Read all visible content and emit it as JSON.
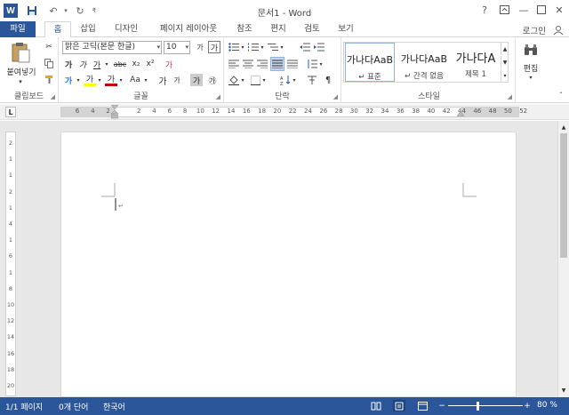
{
  "title": "문서1 - Word",
  "titlebar": {
    "help": "?",
    "undo_icon": "undo-icon",
    "redo_icon": "redo-icon"
  },
  "tabs": [
    "파일",
    "홈",
    "삽입",
    "디자인",
    "페이지 레이아웃",
    "참조",
    "편지",
    "검토",
    "보기"
  ],
  "login": "로그인",
  "clipboard": {
    "paste_label": "붙여넣기",
    "group_label": "클립보드"
  },
  "font": {
    "name": "맑은 고딕(본문 한글)",
    "size": "10",
    "group_label": "글꼴",
    "buttons": {
      "bold": "가",
      "italic": "가",
      "underline": "가",
      "strike": "abc",
      "sub": "x₂",
      "sup": "x²",
      "grow": "가",
      "shrink": "가",
      "clear": "가",
      "highlight": "가",
      "color": "가",
      "case": "Aa",
      "phonetic": "가",
      "border": "가",
      "circle": "㉮",
      "shade": "가"
    }
  },
  "paragraph": {
    "group_label": "단락"
  },
  "styles": {
    "group_label": "스타일",
    "items": [
      {
        "preview": "가나다AaB",
        "name": "↵ 표준"
      },
      {
        "preview": "가나다AaB",
        "name": "↵ 간격 없음"
      },
      {
        "preview": "가나다A",
        "name": "제목 1"
      }
    ]
  },
  "editing": {
    "label": "편집"
  },
  "ruler": {
    "corner": "L",
    "numbers": [
      "6",
      "4",
      "2",
      "",
      "2",
      "4",
      "6",
      "8",
      "10",
      "12",
      "14",
      "16",
      "18",
      "20",
      "22",
      "24",
      "26",
      "28",
      "30",
      "32",
      "34",
      "36",
      "38",
      "40",
      "42",
      "44",
      "46",
      "48",
      "50",
      "52"
    ],
    "vnumbers": [
      "2",
      "1",
      "1",
      "2",
      "1",
      "4",
      "1",
      "6",
      "1",
      "8",
      "10",
      "12",
      "14",
      "16",
      "18",
      "20"
    ]
  },
  "status": {
    "page": "1/1 페이지",
    "words": "0개 단어",
    "language": "한국어",
    "zoom": "80 %",
    "zoom_level_percent": 80
  },
  "colors": {
    "accent": "#2b579a",
    "highlight_yellow": "#ffff00",
    "font_red": "#c00000"
  }
}
